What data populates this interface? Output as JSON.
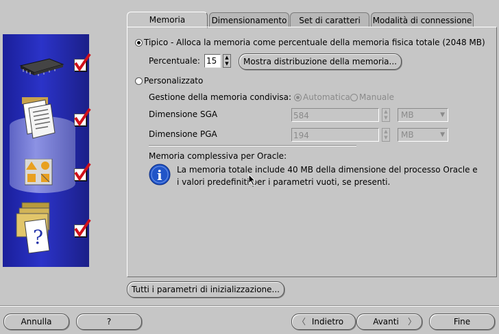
{
  "tabs": [
    {
      "label": "Memoria",
      "active": true
    },
    {
      "label": "Dimensionamento"
    },
    {
      "label": "Set di caratteri"
    },
    {
      "label": "Modalità di connessione"
    }
  ],
  "memory": {
    "typical_label": "Tipico - Alloca la memoria come percentuale della memoria fisica totale (2048 MB)",
    "percent_label": "Percentuale:",
    "percent_value": "15",
    "show_distribution_button": "Mostra distribuzione della memoria...",
    "custom_label": "Personalizzato",
    "shared_mgmt_label": "Gestione della memoria condivisa:",
    "shared_auto": "Automatica",
    "shared_manual": "Manuale",
    "sga_label": "Dimensione SGA",
    "sga_value": "584",
    "sga_unit": "MB",
    "pga_label": "Dimensione PGA",
    "pga_value": "194",
    "pga_unit": "MB",
    "total_label": "Memoria complessiva per Oracle:",
    "info_text": "La memoria totale include 40 MB della dimensione del processo Oracle e i valori predefiniti per i parametri vuoti, se presenti."
  },
  "init_params_button": "Tutti i parametri di inizializzazione...",
  "footer": {
    "cancel": "Annulla",
    "help": "?",
    "back": "Indietro",
    "next": "Avanti",
    "finish": "Fine"
  },
  "colors": {
    "side_panel": "#2b33c8",
    "check": "#d0101a",
    "info_icon": "#2155c8"
  }
}
